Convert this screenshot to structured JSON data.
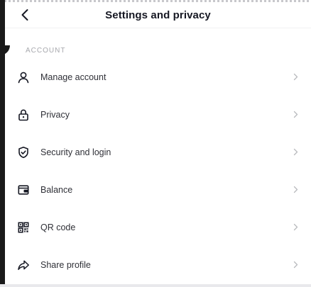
{
  "header": {
    "title": "Settings and privacy",
    "back_icon": "chevron-left-icon"
  },
  "section": {
    "label": "ACCOUNT"
  },
  "items": [
    {
      "label": "Manage account",
      "icon": "person-icon"
    },
    {
      "label": "Privacy",
      "icon": "lock-icon"
    },
    {
      "label": "Security and login",
      "icon": "shield-icon"
    },
    {
      "label": "Balance",
      "icon": "wallet-icon"
    },
    {
      "label": "QR code",
      "icon": "qr-code-icon"
    },
    {
      "label": "Share profile",
      "icon": "share-icon"
    }
  ],
  "colors": {
    "text": "#161823",
    "muted": "#a7a8ad",
    "chevron": "#b9babe"
  }
}
